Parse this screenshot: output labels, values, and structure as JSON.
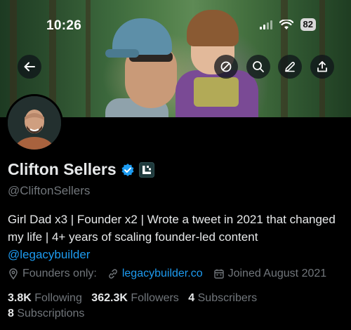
{
  "status_bar": {
    "time": "10:26",
    "battery": "82",
    "icons": [
      "signal-icon",
      "wifi-icon",
      "battery-icon"
    ]
  },
  "banner": {
    "buttons": [
      "back-arrow-icon",
      "no-entry-icon",
      "search-icon",
      "edit-pencil-icon",
      "share-icon"
    ]
  },
  "profile": {
    "name": "Clifton Sellers",
    "handle": "@CliftonSellers",
    "verified_color": "#1d9bf0",
    "bio": "Girl Dad x3 | Founder x2 | Wrote a tweet in 2021 that changed my life | 4+ years of scaling founder-led content",
    "bio_mention": "@legacybuilder",
    "location": "Founders only:",
    "website": "legacybuilder.co",
    "joined": "Joined August 2021"
  },
  "stats": {
    "following_count": "3.8K",
    "following_label": "Following",
    "followers_count": "362.3K",
    "followers_label": "Followers",
    "subscribers_count": "4",
    "subscribers_label": "Subscribers",
    "subscriptions_count": "8",
    "subscriptions_label": "Subscriptions"
  },
  "colors": {
    "background": "#000000",
    "text_primary": "#e7e9ea",
    "text_secondary": "#71767b",
    "link": "#1d9bf0"
  }
}
